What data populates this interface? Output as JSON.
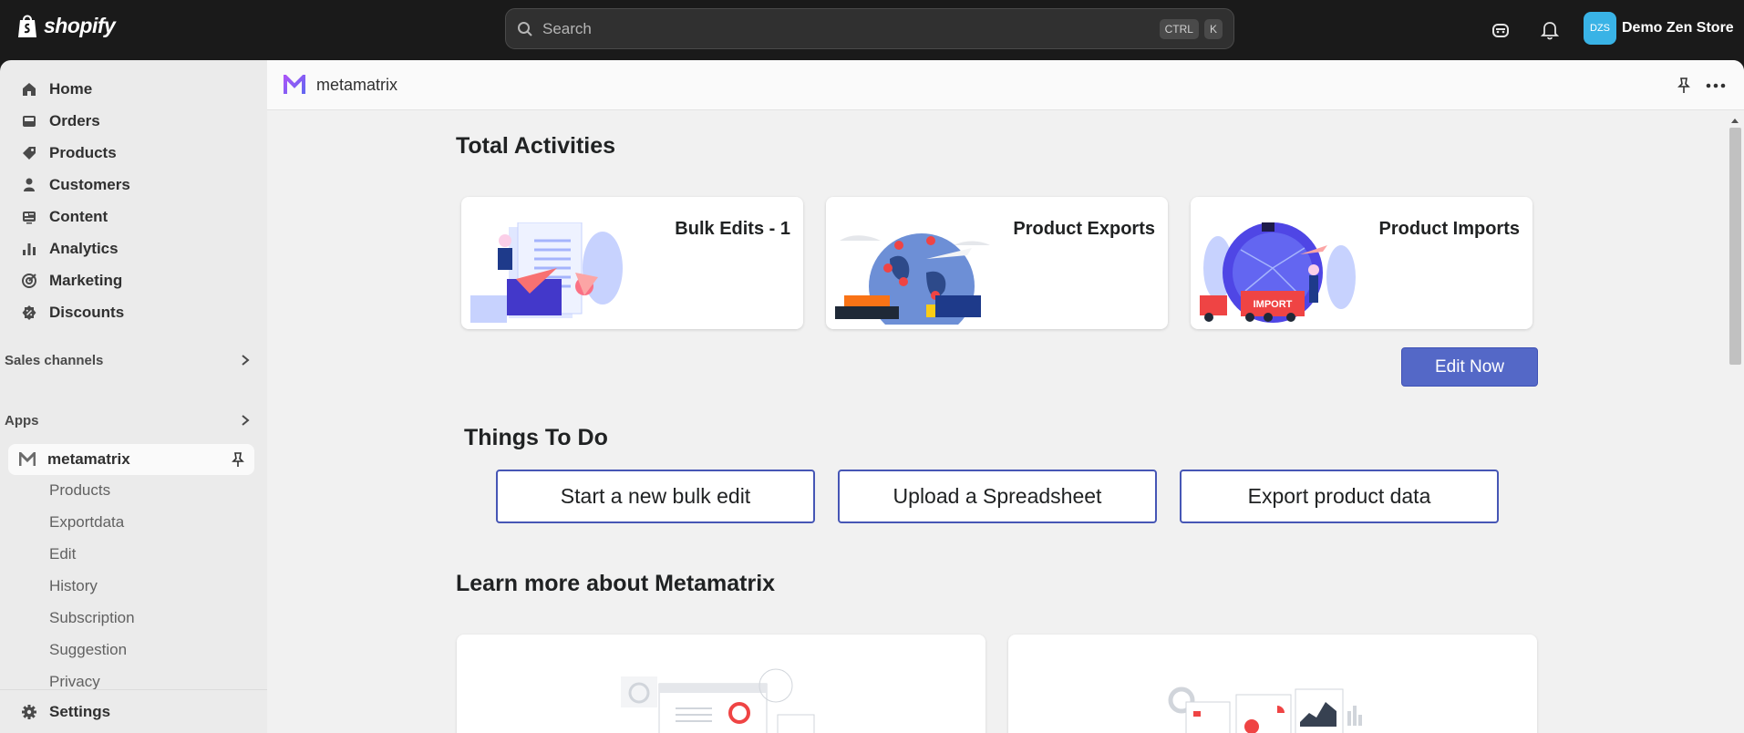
{
  "topbar": {
    "brand": "shopify",
    "search_placeholder": "Search",
    "shortcut_ctrl": "CTRL",
    "shortcut_k": "K",
    "store_initials": "DZS",
    "store_name": "Demo Zen Store"
  },
  "sidebar": {
    "items": [
      {
        "label": "Home",
        "icon": "home-icon"
      },
      {
        "label": "Orders",
        "icon": "inbox-icon"
      },
      {
        "label": "Products",
        "icon": "tag-icon"
      },
      {
        "label": "Customers",
        "icon": "person-icon"
      },
      {
        "label": "Content",
        "icon": "content-icon"
      },
      {
        "label": "Analytics",
        "icon": "bar-chart-icon"
      },
      {
        "label": "Marketing",
        "icon": "target-icon"
      },
      {
        "label": "Discounts",
        "icon": "discount-icon"
      }
    ],
    "sales_channels": "Sales channels",
    "apps": "Apps",
    "app_name": "metamatrix",
    "app_sub_items": [
      "Products",
      "Exportdata",
      "Edit",
      "History",
      "Subscription",
      "Suggestion",
      "Privacy"
    ],
    "settings": "Settings"
  },
  "main": {
    "app_title": "metamatrix",
    "total_activities": "Total Activities",
    "cards": [
      {
        "title": "Bulk Edits - 1"
      },
      {
        "title": "Product Exports"
      },
      {
        "title": "Product Imports"
      }
    ],
    "import_badge": "IMPORT",
    "edit_now": "Edit Now",
    "things_to_do": "Things To Do",
    "todo_buttons": [
      "Start a new bulk edit",
      "Upload a Spreadsheet",
      "Export product data"
    ],
    "learn_more": "Learn more about Metamatrix"
  },
  "colors": {
    "topbar_bg": "#1a1a1a",
    "accent_button": "#5468c7",
    "outline_button": "#4656b5",
    "avatar_bg": "#39b3e6"
  }
}
